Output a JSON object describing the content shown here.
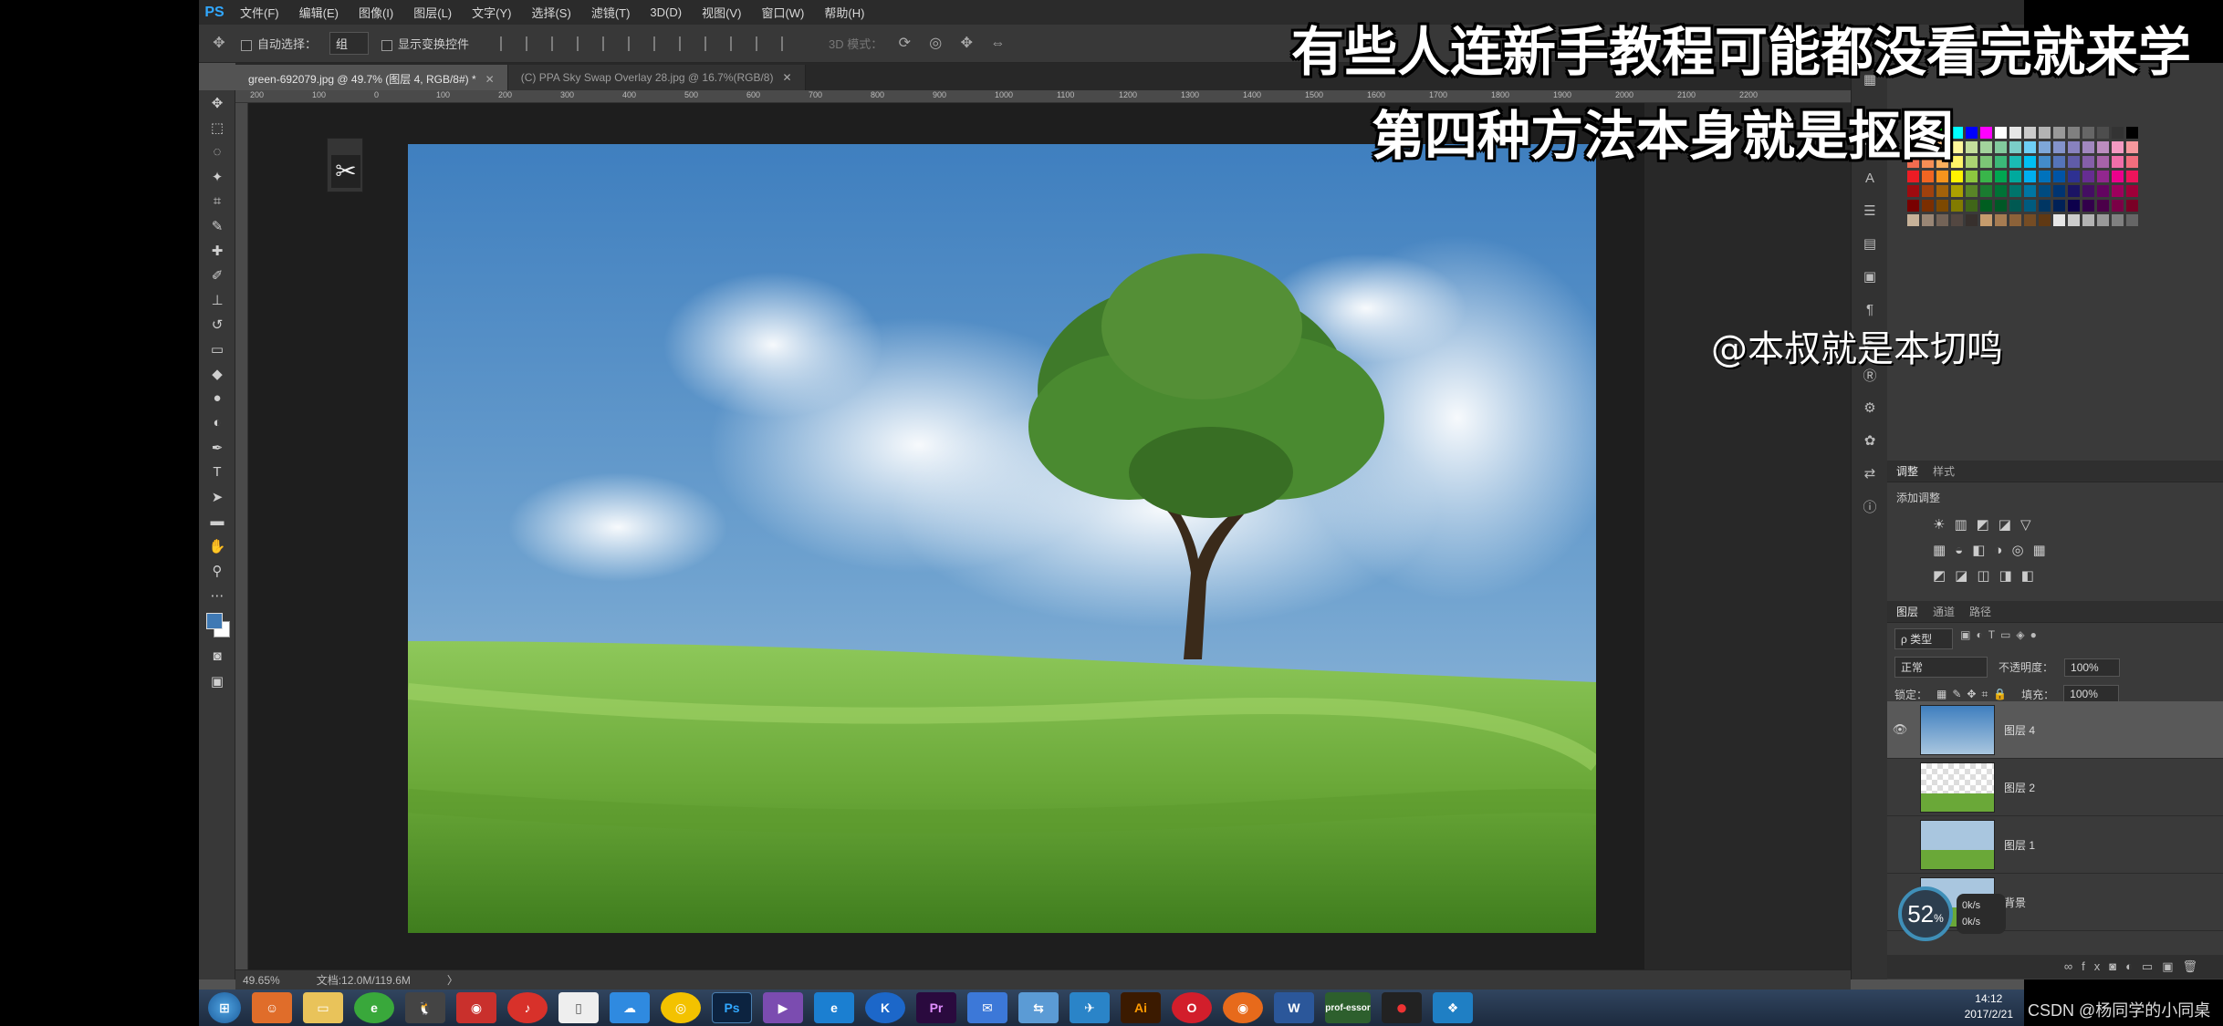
{
  "app": {
    "logo": "PS",
    "menu": [
      "文件(F)",
      "编辑(E)",
      "图像(I)",
      "图层(L)",
      "文字(Y)",
      "选择(S)",
      "滤镜(T)",
      "3D(D)",
      "视图(V)",
      "窗口(W)",
      "帮助(H)"
    ]
  },
  "options": {
    "auto_select_label": "自动选择：",
    "auto_select_value": "组",
    "show_transform_label": "显示变换控件",
    "mode_3d": "3D 模式："
  },
  "tabs": [
    {
      "label": "green-692079.jpg @ 49.7% (图层 4, RGB/8#) *",
      "active": true
    },
    {
      "label": "(C) PPA Sky Swap Overlay 28.jpg @ 16.7%(RGB/8)",
      "active": false
    }
  ],
  "ruler_ticks": [
    "200",
    "100",
    "0",
    "100",
    "200",
    "300",
    "400",
    "500",
    "600",
    "700",
    "800",
    "900",
    "1000",
    "1100",
    "1200",
    "1300",
    "1400",
    "1500",
    "1600",
    "1700",
    "1800",
    "1900",
    "2000",
    "2100",
    "2200"
  ],
  "status": {
    "zoom": "49.65%",
    "doc_size": "文档:12.0M/119.6M",
    "arrow": "〉"
  },
  "panels": {
    "adjustments_tabs": [
      "调整",
      "样式"
    ],
    "add_adjustment": "添加调整",
    "layers_tabs": [
      "图层",
      "通道",
      "路径"
    ],
    "filter_kind": "ρ 类型",
    "blend_mode": "正常",
    "opacity_label": "不透明度：",
    "opacity_value": "100%",
    "lock_label": "锁定：",
    "fill_label": "填充：",
    "fill_value": "100%",
    "layers": [
      {
        "name": "图层 4",
        "selected": true,
        "visible": true,
        "thumb": "sky"
      },
      {
        "name": "图层 2",
        "selected": false,
        "visible": false,
        "thumb": "tree-transparent"
      },
      {
        "name": "图层 1",
        "selected": false,
        "visible": false,
        "thumb": "full"
      },
      {
        "name": "背景",
        "selected": false,
        "visible": false,
        "thumb": "full"
      }
    ],
    "swatch_colors": [
      "#ff0000",
      "#ffff00",
      "#00ff00",
      "#00ffff",
      "#0000ff",
      "#ff00ff",
      "#ffffff",
      "#e6e6e6",
      "#cccccc",
      "#b3b3b3",
      "#999999",
      "#808080",
      "#666666",
      "#4d4d4d",
      "#333333",
      "#000000",
      "#f7977a",
      "#f9ad81",
      "#fdc68a",
      "#fff79a",
      "#c4df9b",
      "#a2d39c",
      "#82ca9d",
      "#7bcdc8",
      "#6ecff6",
      "#7ea7d8",
      "#8493ca",
      "#8882be",
      "#a187be",
      "#bc8dbf",
      "#f49ac2",
      "#f6989d",
      "#f26c4f",
      "#f68e55",
      "#fbaf5c",
      "#fff467",
      "#acd372",
      "#7cc576",
      "#3bb878",
      "#1abbb4",
      "#00bff3",
      "#438cca",
      "#5574b9",
      "#605ca8",
      "#855fa8",
      "#a763a8",
      "#f06ea9",
      "#f26d7d",
      "#ed1c24",
      "#f26522",
      "#f7941d",
      "#fff200",
      "#8dc73f",
      "#39b54a",
      "#00a651",
      "#00a99d",
      "#00aeef",
      "#0072bc",
      "#0054a6",
      "#2e3192",
      "#662d91",
      "#92278f",
      "#ec008c",
      "#ed145b",
      "#9e0b0f",
      "#a0410d",
      "#a3620a",
      "#aba000",
      "#598527",
      "#1a7b30",
      "#007236",
      "#00746b",
      "#0076a3",
      "#004b80",
      "#003471",
      "#1b1464",
      "#440e62",
      "#630460",
      "#9e005d",
      "#9e0039",
      "#790000",
      "#7b2e00",
      "#7d4900",
      "#827b00",
      "#406618",
      "#005e20",
      "#005826",
      "#005952",
      "#005b7f",
      "#003663",
      "#002157",
      "#0d004c",
      "#32004b",
      "#4b0049",
      "#7b0046",
      "#7a0026",
      "#c7b299",
      "#998675",
      "#736357",
      "#534741",
      "#37302d",
      "#c69c6d",
      "#a67c52",
      "#8c6239",
      "#754c24",
      "#603913",
      "#e6e6e6",
      "#cccccc",
      "#b3b3b3",
      "#999999",
      "#808080",
      "#666666"
    ]
  },
  "overlay": {
    "subtitle_line1": "有些人连新手教程可能都没看完就来学",
    "subtitle_line2": "第四种方法本身就是抠图",
    "handle": "@本叔就是本切鸣",
    "speed_value": "52",
    "speed_unit": "%",
    "net_up": "0k/s",
    "net_down": "0k/s"
  },
  "taskbar": {
    "apps": [
      "start",
      "user",
      "folder",
      "browser-360",
      "qq",
      "weibo",
      "netease",
      "file",
      "cloud",
      "chrome",
      "photoshop",
      "media",
      "ie",
      "kugou",
      "premiere",
      "mail",
      "network",
      "tool",
      "acrobat",
      "opera",
      "firefox",
      "word",
      "professor",
      "record",
      "app"
    ],
    "professor_label": "prof-essor",
    "time": "14:12",
    "date": "2017/2/21"
  },
  "watermark": "CSDN @杨同学的小同桌"
}
